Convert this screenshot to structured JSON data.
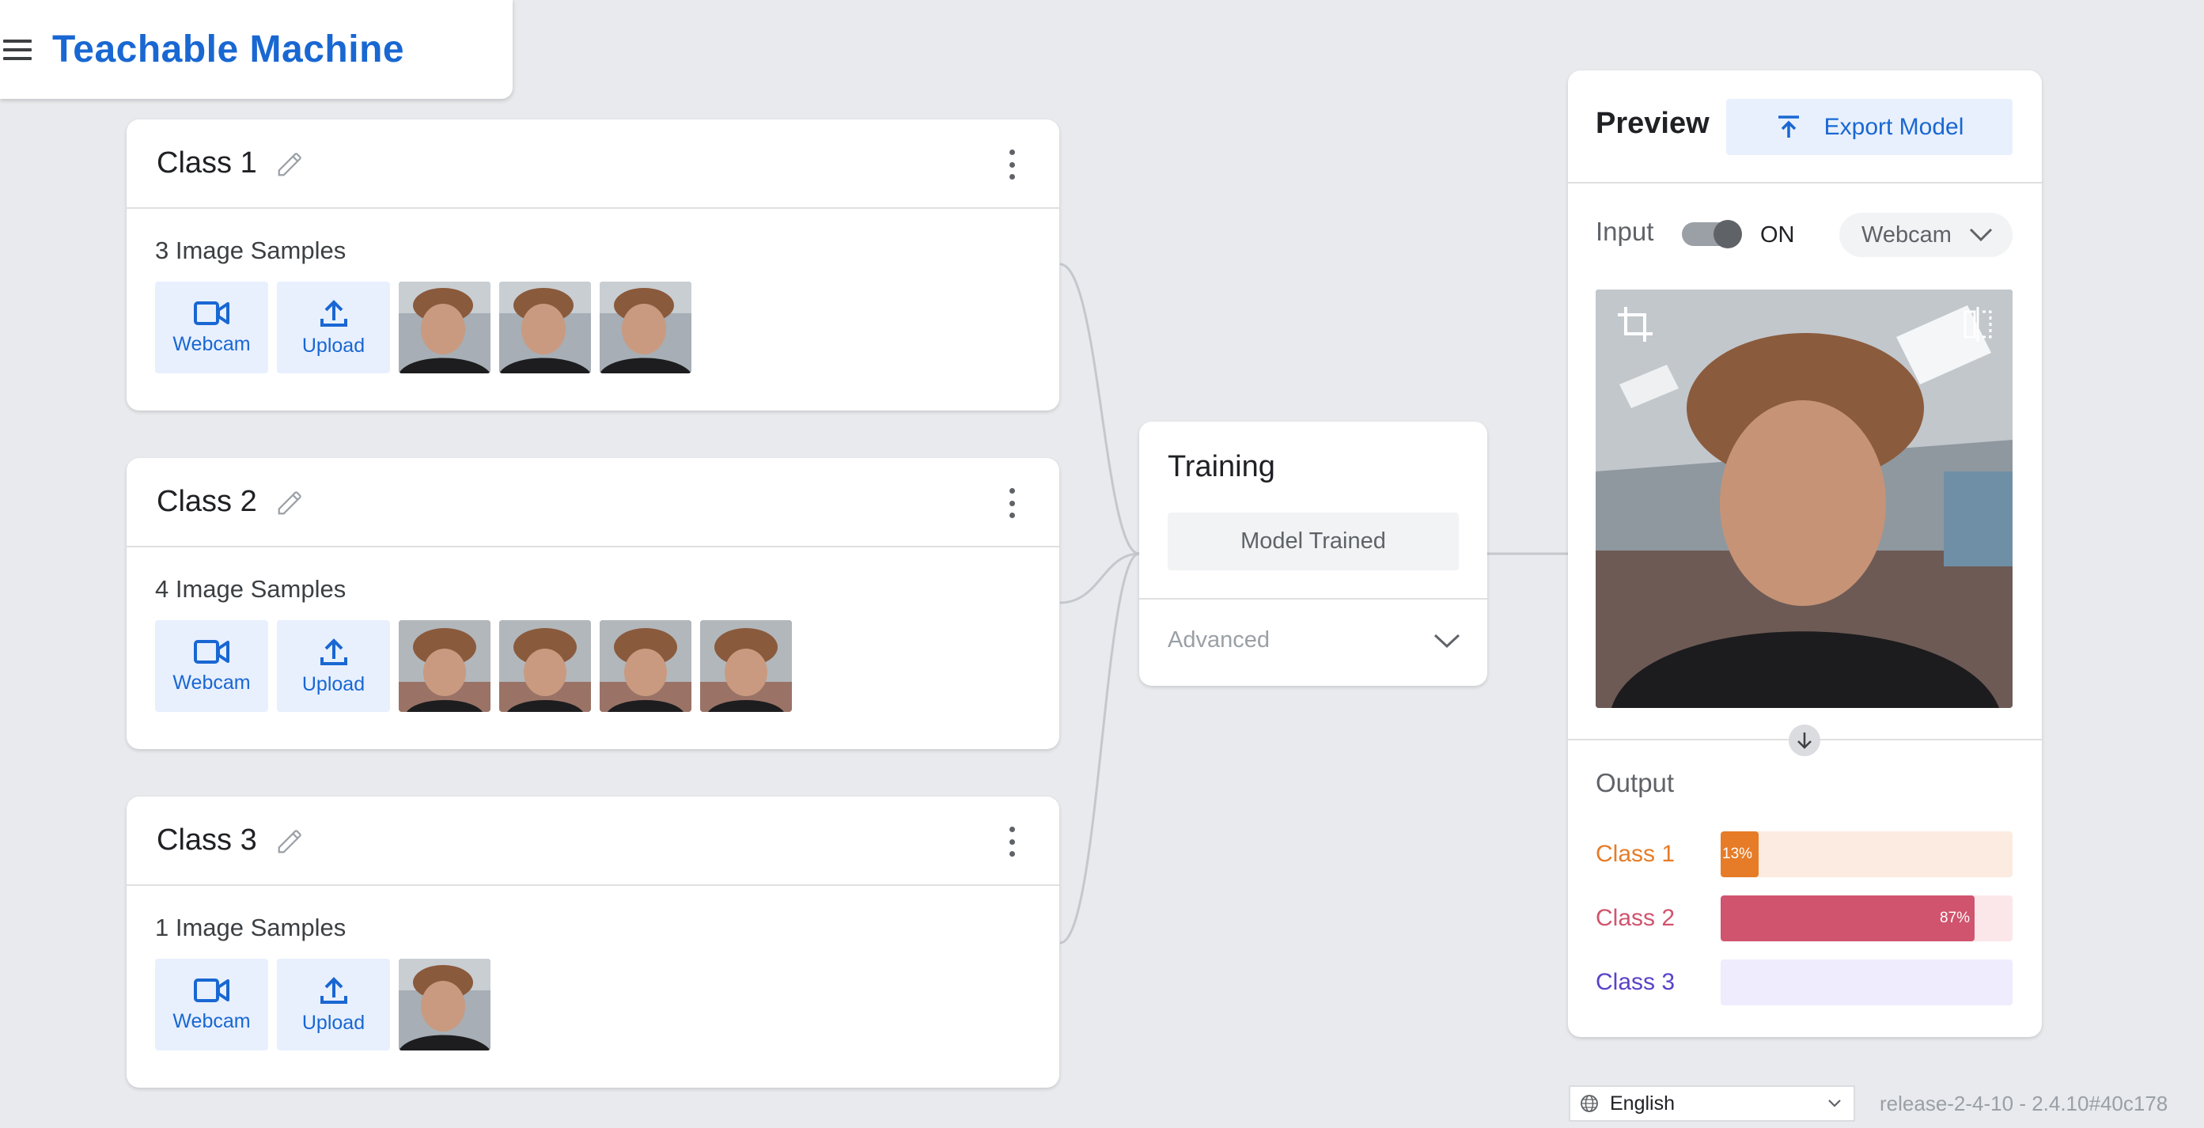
{
  "header": {
    "title": "Teachable Machine"
  },
  "classes": [
    {
      "name": "Class 1",
      "samples_label": "3 Image Samples",
      "thumb_count": 3,
      "webcam_label": "Webcam",
      "upload_label": "Upload"
    },
    {
      "name": "Class 2",
      "samples_label": "4 Image Samples",
      "thumb_count": 4,
      "webcam_label": "Webcam",
      "upload_label": "Upload"
    },
    {
      "name": "Class 3",
      "samples_label": "1 Image Samples",
      "thumb_count": 1,
      "webcam_label": "Webcam",
      "upload_label": "Upload"
    }
  ],
  "training": {
    "title": "Training",
    "button_label": "Model Trained",
    "advanced_label": "Advanced"
  },
  "preview": {
    "title": "Preview",
    "export_label": "Export Model",
    "input_label": "Input",
    "toggle_state": "ON",
    "source_label": "Webcam",
    "output_label": "Output",
    "outputs": [
      {
        "name": "Class 1",
        "percent": 13,
        "percent_label": "13%",
        "color": "#e67c27",
        "track": "#fcebe0"
      },
      {
        "name": "Class 2",
        "percent": 87,
        "percent_label": "87%",
        "color": "#d0546e",
        "track": "#fbe6ea"
      },
      {
        "name": "Class 3",
        "percent": 0,
        "percent_label": "",
        "color": "#5a42c8",
        "track": "#eeecfd"
      }
    ]
  },
  "footer": {
    "language": "English",
    "release": "release-2-4-10 - 2.4.10#40c178"
  },
  "colors": {
    "accent": "#1967d2",
    "background": "#e8eaed"
  }
}
